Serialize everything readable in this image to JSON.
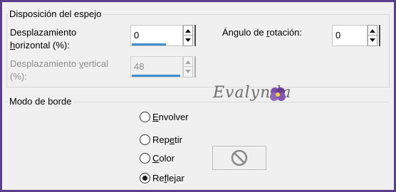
{
  "mirror_group": {
    "title": "Disposición del espejo",
    "horizontal_label_pre": "Desplazamiento",
    "horizontal_label_line2_pre": "",
    "horizontal_label_line2_u": "h",
    "horizontal_label_line2_post": "orizontal (%):",
    "horizontal_value": "0",
    "vertical_label_line1_pre": "Desplazamiento ",
    "vertical_label_line1_u": "v",
    "vertical_label_line1_post": "ertical",
    "vertical_label_line2": "(%):",
    "vertical_value": "48",
    "rotation_label_pre": "Ángulo de ",
    "rotation_label_u": "r",
    "rotation_label_post": "otación:",
    "rotation_value": "0"
  },
  "border_group": {
    "title": "Modo de borde",
    "options": [
      {
        "pre": "",
        "u": "E",
        "post": "nvolver",
        "checked": false
      },
      {
        "pre": "Rep",
        "u": "e",
        "post": "tir",
        "checked": false
      },
      {
        "pre": "",
        "u": "C",
        "post": "olor",
        "checked": false
      },
      {
        "pre": "Re",
        "u": "f",
        "post": "lejar",
        "checked": true
      }
    ]
  },
  "watermark": {
    "text": "Evalynda"
  },
  "icons": {
    "spin_up": "arrow-up-icon",
    "spin_down": "arrow-down-icon",
    "no_color": "no-color-icon"
  },
  "colors": {
    "frame": "#5b3f8c",
    "accent": "#3f8fd2"
  }
}
